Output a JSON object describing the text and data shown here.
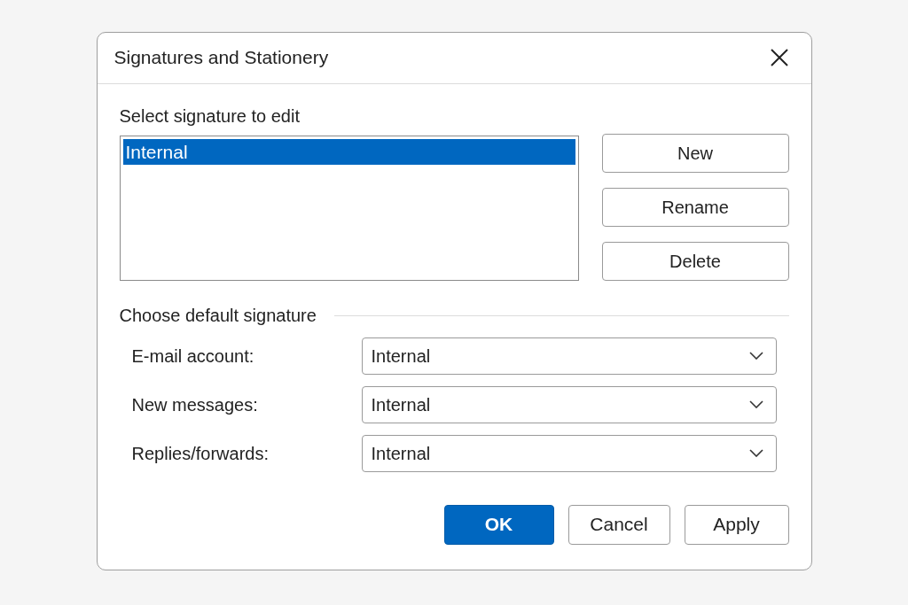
{
  "window": {
    "title": "Signatures and Stationery"
  },
  "signature_list": {
    "label": "Select signature to edit",
    "items": [
      {
        "name": "Internal",
        "selected": true
      }
    ]
  },
  "side_buttons": [
    "New",
    "Rename",
    "Delete"
  ],
  "default_signature": {
    "heading": "Choose default signature",
    "fields": [
      {
        "label": "E-mail account:",
        "value": "Internal"
      },
      {
        "label": "New messages:",
        "value": "Internal"
      },
      {
        "label": "Replies/forwards:",
        "value": "Internal"
      }
    ]
  },
  "buttons": [
    {
      "label": "OK",
      "kind": "primary"
    },
    {
      "label": "Cancel",
      "kind": "default"
    },
    {
      "label": "Apply",
      "kind": "default"
    }
  ]
}
